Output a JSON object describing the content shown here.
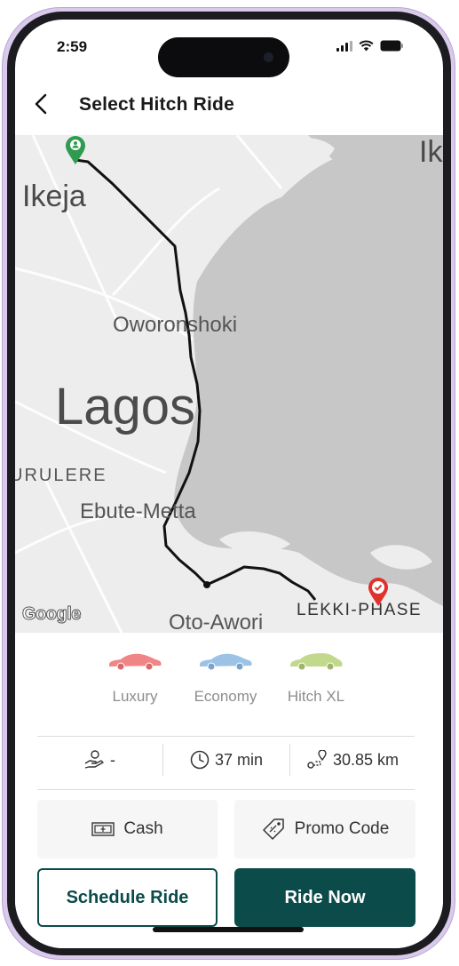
{
  "status_bar": {
    "time": "2:59"
  },
  "header": {
    "title": "Select Hitch Ride"
  },
  "map": {
    "labels": {
      "ikeja": "Ikeja",
      "ik_partial": "Ik",
      "oworonshoki": "Oworonshoki",
      "lagos": "Lagos",
      "surulere": "URULERE",
      "ebute_metta": "Ebute-Metta",
      "oto_awori": "Oto-Awori",
      "lekki": "LEKKI-PHASE",
      "google": "Google"
    },
    "colors": {
      "route": "#111111",
      "start_pin": "#2e9b4e",
      "end_pin": "#e0322d",
      "water": "#c8c8c8",
      "land": "#ededed"
    }
  },
  "rides": [
    {
      "label": "Luxury",
      "color": "#f08585"
    },
    {
      "label": "Economy",
      "color": "#9cc2e6"
    },
    {
      "label": "Hitch XL",
      "color": "#c2d98c"
    }
  ],
  "trip": {
    "fare": "-",
    "duration": "37 min",
    "distance": "30.85 km"
  },
  "payment": {
    "method": "Cash",
    "promo": "Promo Code"
  },
  "actions": {
    "schedule": "Schedule Ride",
    "ride_now": "Ride Now"
  },
  "theme": {
    "primary": "#0b4b4a"
  }
}
